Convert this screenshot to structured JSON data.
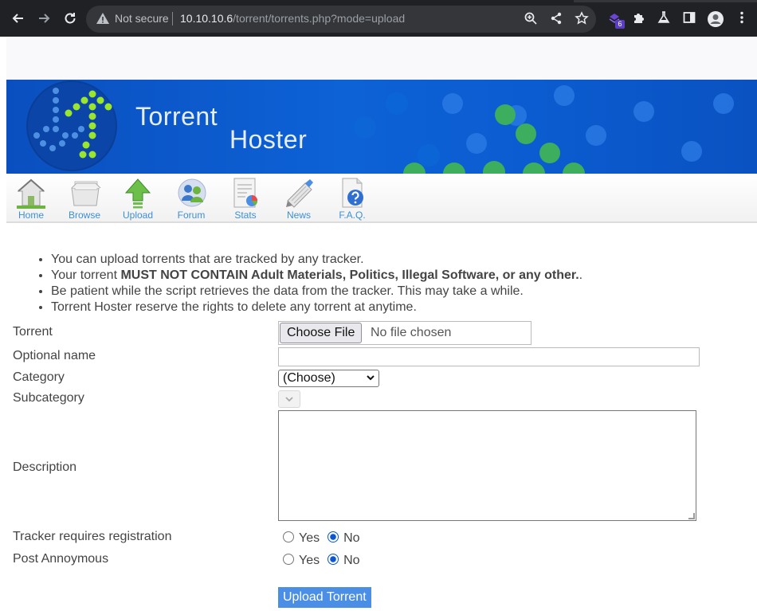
{
  "browser": {
    "security_label": "Not secure",
    "url_host": "10.10.10.6",
    "url_path": "/torrent/torrents.php?mode=upload",
    "extension_badge": "6",
    "icons": [
      "back-icon",
      "forward-icon",
      "reload-icon",
      "warning-icon",
      "zoom-icon",
      "share-icon",
      "star-icon",
      "extension-icon",
      "puzzle-icon",
      "flask-icon",
      "sidepanel-icon",
      "profile-icon",
      "kebab-menu-icon"
    ]
  },
  "header": {
    "title_line1": "Torrent",
    "title_line2": "Hoster"
  },
  "nav": {
    "items": [
      {
        "label": "Home",
        "icon": "home-icon"
      },
      {
        "label": "Browse",
        "icon": "browse-icon"
      },
      {
        "label": "Upload",
        "icon": "upload-icon"
      },
      {
        "label": "Forum",
        "icon": "forum-icon"
      },
      {
        "label": "Stats",
        "icon": "stats-icon"
      },
      {
        "label": "News",
        "icon": "news-icon"
      },
      {
        "label": "F.A.Q.",
        "icon": "faq-icon"
      }
    ]
  },
  "rules": {
    "item1": "You can upload torrents that are tracked by any tracker.",
    "item2_prefix": "Your torrent ",
    "item2_bold": "MUST NOT CONTAIN Adult Materials, Politics, Illegal Software, or any other.",
    "item2_suffix": ".",
    "item3": "Be patient while the script retrieves the data from the tracker. This may take a while.",
    "item4": "Torrent Hoster reserve the rights to delete any torrent at anytime."
  },
  "form": {
    "torrent_label": "Torrent",
    "choose_file_label": "Choose File",
    "no_file_text": "No file chosen",
    "optional_name_label": "Optional name",
    "optional_name_value": "",
    "category_label": "Category",
    "category_selected": "(Choose)",
    "subcategory_label": "Subcategory",
    "description_label": "Description",
    "description_value": "",
    "tracker_reg_label": "Tracker requires registration",
    "post_anon_label": "Post Annoymous",
    "yes_label": "Yes",
    "no_label": "No",
    "tracker_reg_selected": "No",
    "post_anon_selected": "No",
    "submit_label": "Upload Torrent"
  },
  "colors": {
    "banner_blue": "#0d62d6",
    "nav_text": "#3d8fd6",
    "submit_bg": "#4a8ee6",
    "chrome_bg": "#202124"
  }
}
